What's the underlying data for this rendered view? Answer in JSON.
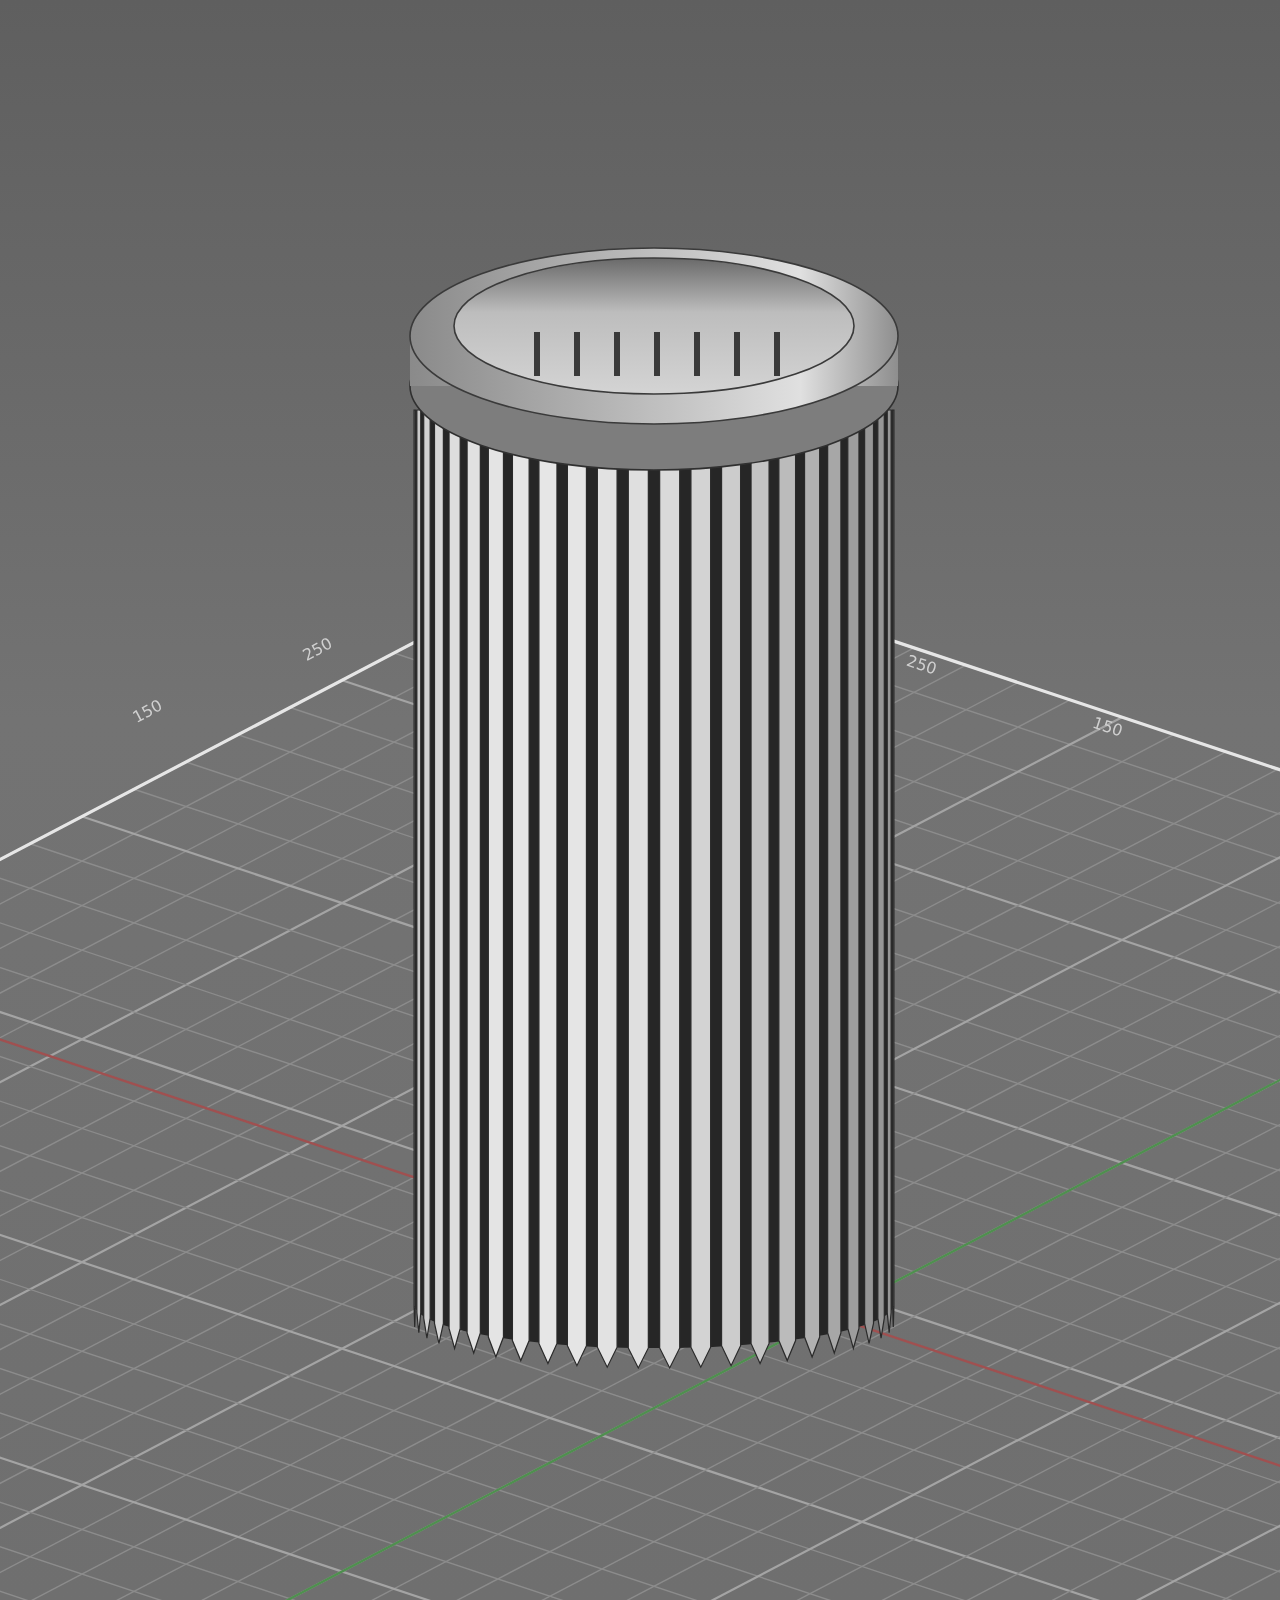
{
  "viewport": {
    "grid_labels": [
      {
        "text": "150"
      },
      {
        "text": "250"
      },
      {
        "text": "250"
      },
      {
        "text": "150"
      }
    ]
  }
}
